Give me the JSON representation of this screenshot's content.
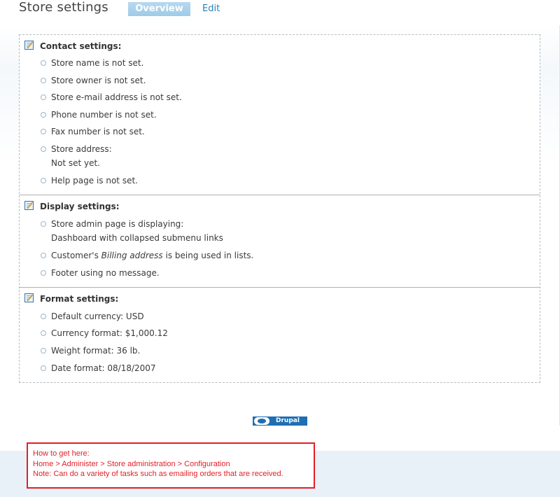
{
  "header": {
    "title": "Store settings",
    "tabs": [
      {
        "label": "Overview",
        "active": true
      },
      {
        "label": "Edit",
        "active": false
      }
    ]
  },
  "sections": [
    {
      "title": "Contact settings:",
      "icon": "edit-icon",
      "items": [
        {
          "text": "Store name is not set."
        },
        {
          "text": "Store owner is not set."
        },
        {
          "text": "Store e-mail address is not set."
        },
        {
          "text": "Phone number is not set."
        },
        {
          "text": "Fax number is not set."
        },
        {
          "text": "Store address:",
          "line2": "Not set yet."
        },
        {
          "text": "Help page is not set."
        }
      ]
    },
    {
      "title": "Display settings:",
      "icon": "edit-icon",
      "items": [
        {
          "text": "Store admin page is displaying:",
          "line2": "Dashboard with collapsed submenu links"
        },
        {
          "text_before": "Customer's ",
          "text_em": "Billing address",
          "text_after": " is being used in lists."
        },
        {
          "text": "Footer using no message."
        }
      ]
    },
    {
      "title": "Format settings:",
      "icon": "edit-icon",
      "items": [
        {
          "text": "Default currency: USD"
        },
        {
          "text": "Currency format: $1,000.12"
        },
        {
          "text": "Weight format: 36 lb."
        },
        {
          "text": "Date format: 08/18/2007"
        }
      ]
    }
  ],
  "footer": {
    "badge_text": "Drupal"
  },
  "note": {
    "line1": "How to get here:",
    "line2": "Home > Administer > Store administration > Configuration",
    "line3": "Note: Can do a variety of tasks such as emailing orders that are received."
  },
  "colors": {
    "accent": "#2b7fb5",
    "tab_active_bg": "#a6cfe9",
    "note_red": "#e21f26"
  }
}
